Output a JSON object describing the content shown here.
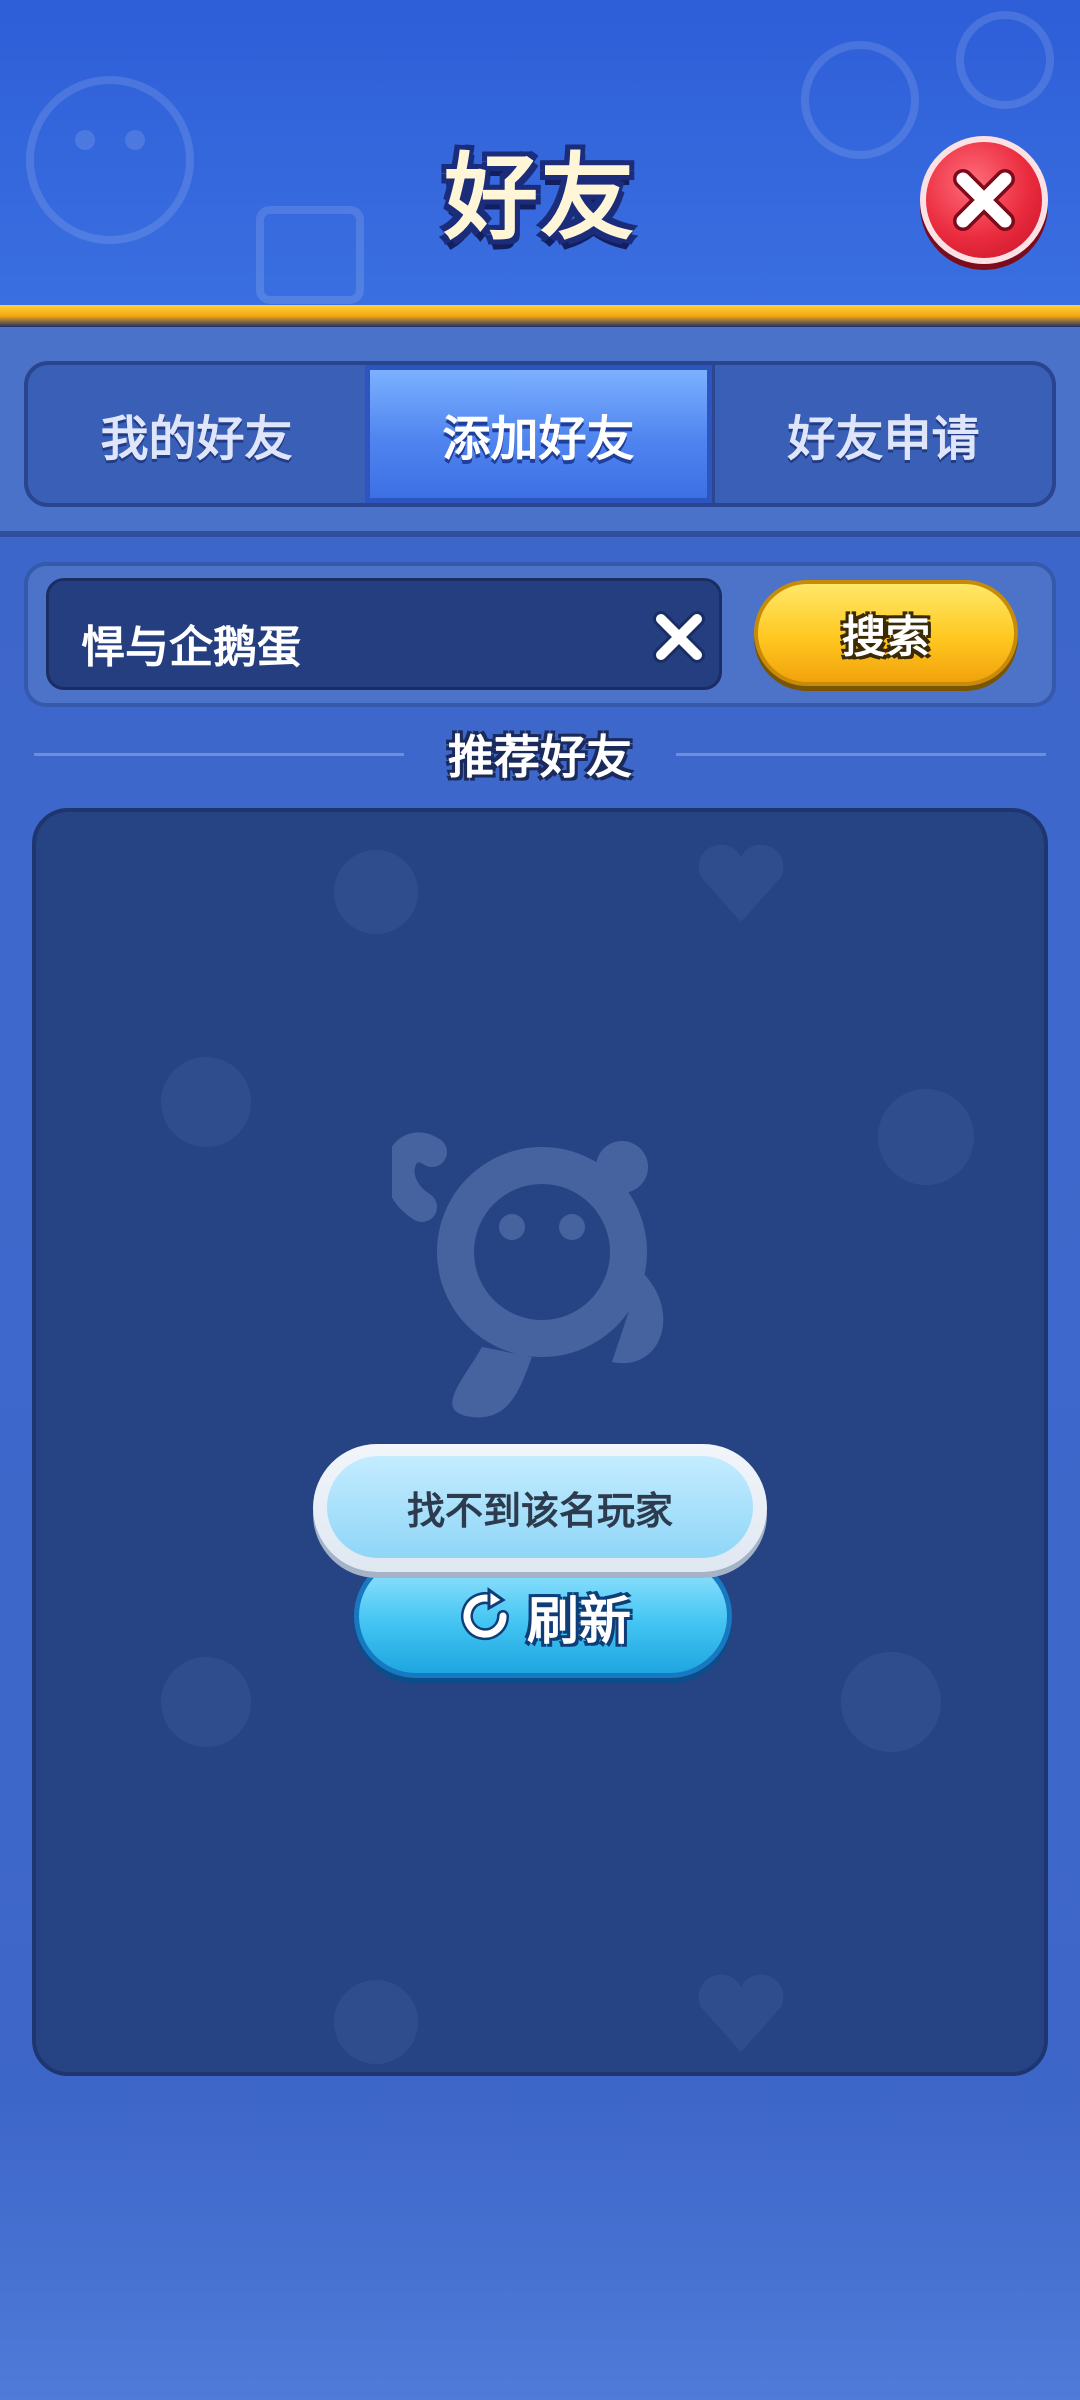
{
  "header": {
    "title": "好友",
    "close_icon": "close-icon"
  },
  "tabs": [
    {
      "label": "我的好友",
      "active": false
    },
    {
      "label": "添加好友",
      "active": true
    },
    {
      "label": "好友申请",
      "active": false
    }
  ],
  "search": {
    "value": "悍与企鹅蛋",
    "clear_icon": "clear-icon",
    "button_label": "搜索"
  },
  "recommend": {
    "title": "推荐好友",
    "refresh_label": "刷新",
    "refresh_icon": "refresh-icon"
  },
  "toast": {
    "message": "找不到该名玩家"
  },
  "colors": {
    "accent_blue": "#4f84f0",
    "search_yellow": "#ffc820",
    "close_red": "#ea2b3e",
    "refresh_cyan": "#44c5f3"
  }
}
